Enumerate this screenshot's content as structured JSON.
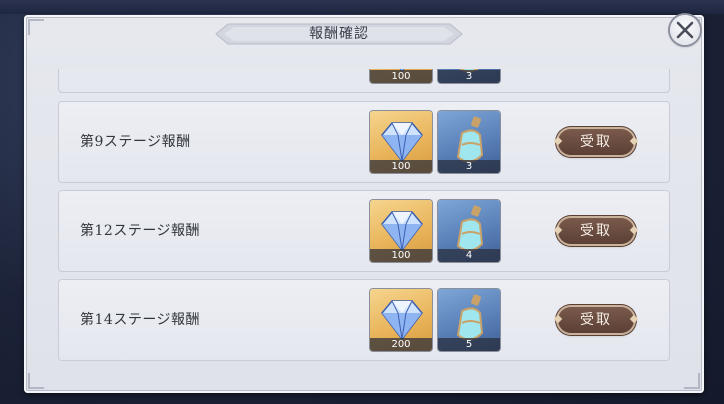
{
  "dialog": {
    "title": "報酬確認",
    "close_icon": "close-icon"
  },
  "rewards": [
    {
      "label": "",
      "items": [
        {
          "icon": "diamond-icon",
          "amount": "100"
        },
        {
          "icon": "potion-icon",
          "amount": "3"
        }
      ],
      "claim_label": ""
    },
    {
      "label": "第9ステージ報酬",
      "items": [
        {
          "icon": "diamond-icon",
          "amount": "100"
        },
        {
          "icon": "potion-icon",
          "amount": "3"
        }
      ],
      "claim_label": "受取"
    },
    {
      "label": "第12ステージ報酬",
      "items": [
        {
          "icon": "diamond-icon",
          "amount": "100"
        },
        {
          "icon": "potion-icon",
          "amount": "4"
        }
      ],
      "claim_label": "受取"
    },
    {
      "label": "第14ステージ報酬",
      "items": [
        {
          "icon": "diamond-icon",
          "amount": "200"
        },
        {
          "icon": "potion-icon",
          "amount": "5"
        }
      ],
      "claim_label": "受取"
    }
  ],
  "colors": {
    "panel": "#e6e8ee",
    "claim_button": "#5b3f35",
    "gold_item": "#e9b55c",
    "blue_item": "#5a80b8"
  }
}
